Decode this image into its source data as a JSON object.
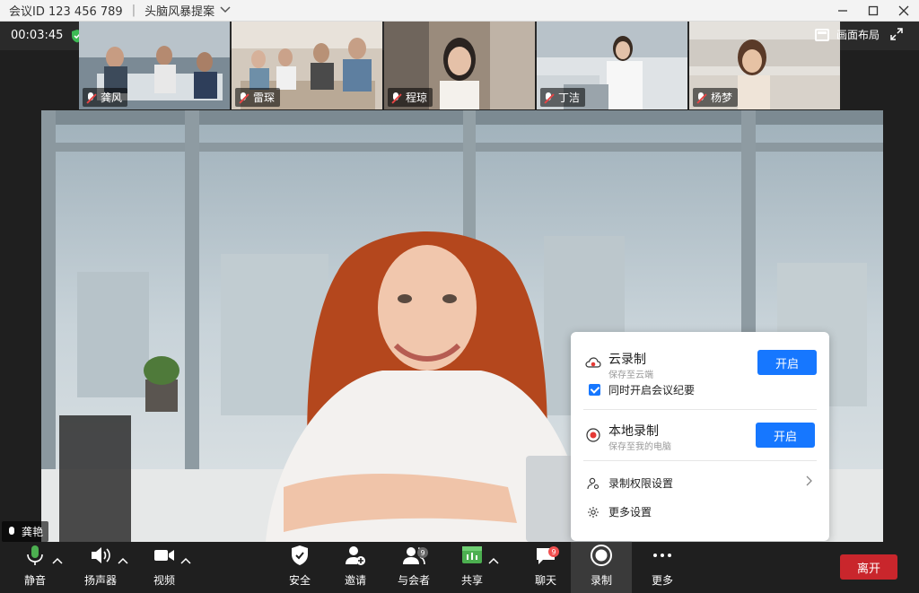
{
  "window": {
    "meeting_id": "会议ID 123 456 789",
    "meeting_title": "头脑风暴提案"
  },
  "top": {
    "timer": "00:03:45",
    "layout_label": "画面布局"
  },
  "participants": [
    {
      "name": "龚风"
    },
    {
      "name": "雷琛"
    },
    {
      "name": "程琼"
    },
    {
      "name": "丁洁"
    },
    {
      "name": "杨梦"
    }
  ],
  "main_speaker": "龚艳",
  "record_popup": {
    "cloud": {
      "title": "云录制",
      "subtitle": "保存至云端",
      "button": "开启"
    },
    "minutes_checkbox": {
      "label": "同时开启会议纪要",
      "checked": true
    },
    "local": {
      "title": "本地录制",
      "subtitle": "保存至我的电脑",
      "button": "开启"
    },
    "permissions_label": "录制权限设置",
    "more_settings_label": "更多设置"
  },
  "toolbar": {
    "mute": "静音",
    "speaker": "扬声器",
    "video": "视频",
    "security": "安全",
    "invite": "邀请",
    "participants": "与会者",
    "participants_count": "9",
    "share": "共享",
    "chat": "聊天",
    "chat_badge": "9",
    "record": "录制",
    "more": "更多",
    "leave": "离开"
  },
  "colors": {
    "accent": "#1677ff",
    "leave": "#c9262c",
    "signal": "#6ad26a",
    "secure": "#3cba54"
  }
}
